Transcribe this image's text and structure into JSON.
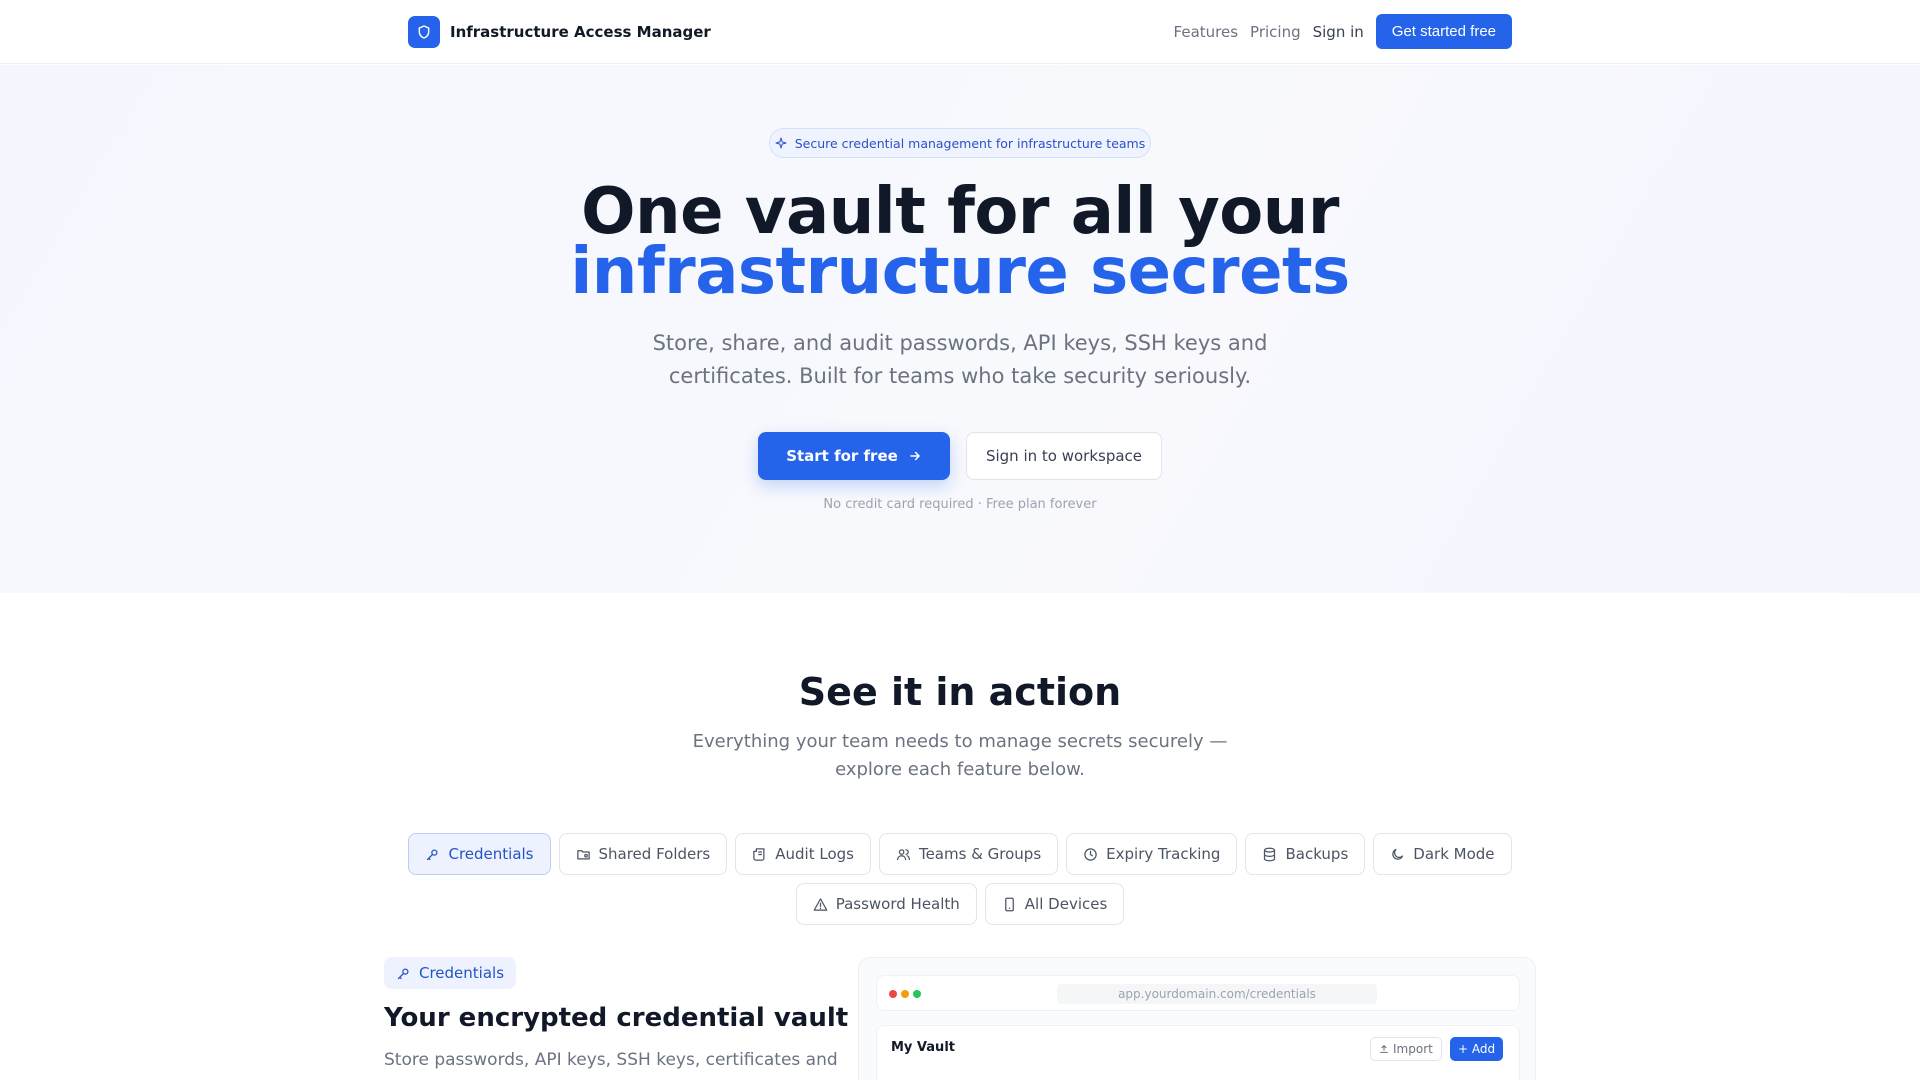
{
  "nav": {
    "brand": "Infrastructure Access Manager",
    "links": [
      "Features",
      "Pricing",
      "Sign in"
    ],
    "cta": "Get started free"
  },
  "hero": {
    "badge": "Secure credential management for infrastructure teams",
    "title_line1": "One vault for all your",
    "title_line2": "infrastructure secrets",
    "subtitle": "Store, share, and audit passwords, API keys, SSH keys and certificates. Built for teams who take security seriously.",
    "primary_cta": "Start for free",
    "secondary_cta": "Sign in to workspace",
    "note": "No credit card required · Free plan forever"
  },
  "section": {
    "title": "See it in action",
    "subtitle": "Everything your team needs to manage secrets securely — explore each feature below."
  },
  "tabs": [
    {
      "label": "Credentials",
      "icon": "key-icon",
      "active": true
    },
    {
      "label": "Shared Folders",
      "icon": "folder-share-icon",
      "active": false
    },
    {
      "label": "Audit Logs",
      "icon": "scroll-icon",
      "active": false
    },
    {
      "label": "Teams & Groups",
      "icon": "users-icon",
      "active": false
    },
    {
      "label": "Expiry Tracking",
      "icon": "clock-icon",
      "active": false
    },
    {
      "label": "Backups",
      "icon": "database-icon",
      "active": false
    },
    {
      "label": "Dark Mode",
      "icon": "moon-icon",
      "active": false
    },
    {
      "label": "Password Health",
      "icon": "warning-icon",
      "active": false
    },
    {
      "label": "All Devices",
      "icon": "smartphone-icon",
      "active": false
    }
  ],
  "feature": {
    "badge": "Credentials",
    "title": "Your encrypted credential vault",
    "description": "Store passwords, API keys, SSH keys, certificates and"
  },
  "mockup": {
    "url": "app.yourdomain.com/credentials",
    "vault_title": "My Vault",
    "import_label": "Import",
    "add_label": "+ Add"
  },
  "colors": {
    "accent": "#2563eb",
    "window_dots": [
      "#ef4444",
      "#f59e0b",
      "#22c55e"
    ]
  }
}
